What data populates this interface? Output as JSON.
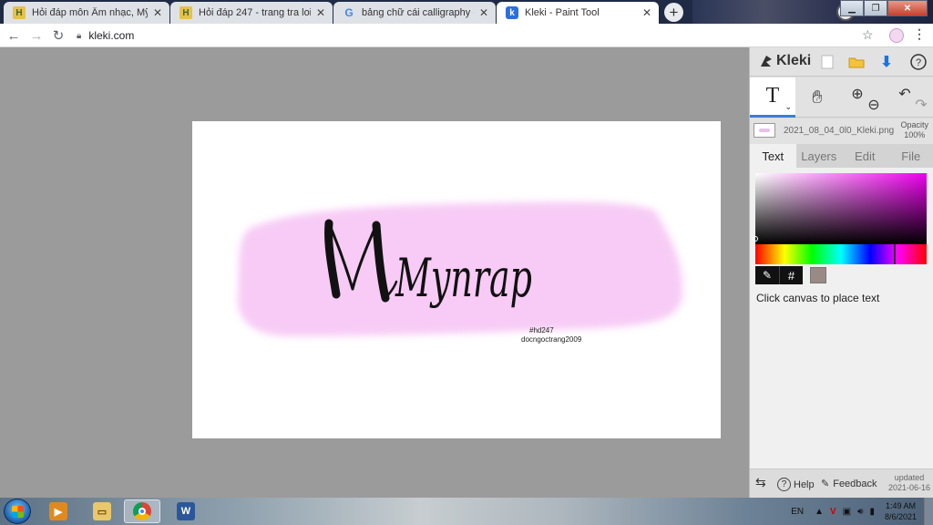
{
  "browser": {
    "tabs": [
      {
        "title": "Hỏi đáp môn Âm nhạc, Mỹ thuật",
        "icon": "hoidap-favicon-icon"
      },
      {
        "title": "Hỏi đáp 247 - trang tra loi",
        "icon": "hoidap-favicon-icon"
      },
      {
        "title": "bảng chữ cái calligraphy - Google",
        "icon": "google-favicon-icon"
      },
      {
        "title": "Kleki - Paint Tool",
        "icon": "kleki-favicon-icon"
      }
    ],
    "url": "kleki.com"
  },
  "canvas": {
    "title_text": "Mynrap",
    "small_text_1": "#hd247",
    "small_text_2": "docngoctrang2009",
    "colors": {
      "brush": "#f7c9f5",
      "ink": "#111111"
    }
  },
  "panel": {
    "brand": "Kleki",
    "layer_name": "2021_08_04_0l0_Kleki.png",
    "opacity_label": "Opacity",
    "opacity_value": "100%",
    "tabs": [
      "Text",
      "Layers",
      "Edit",
      "File"
    ],
    "active_tab": "Text",
    "hint": "Click canvas to place text",
    "tool_label": "T",
    "footer": {
      "help": "Help",
      "feedback": "Feedback",
      "updated_label": "updated",
      "updated_date": "2021-06-16"
    },
    "colors": {
      "accent": "#3b7fd9",
      "swatch": "#9a8a85"
    }
  },
  "taskbar": {
    "lang": "EN",
    "time": "1:49 AM",
    "date": "8/6/2021"
  }
}
